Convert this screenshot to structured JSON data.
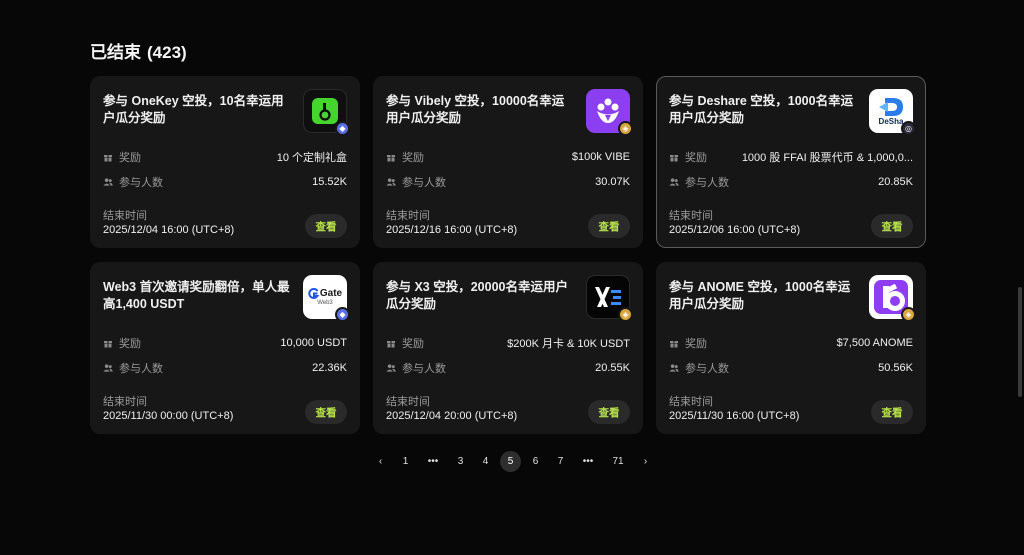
{
  "header": {
    "title": "已结束",
    "count": "(423)"
  },
  "labels": {
    "reward": "奖励",
    "participants": "参与人数",
    "end_time": "结束时间",
    "view": "查看"
  },
  "cards": [
    {
      "title": "参与 OneKey 空投，10名幸运用户瓜分奖励",
      "logo": "onekey-logo",
      "chain": "eth",
      "reward": "10 个定制礼盒",
      "participants": "15.52K",
      "end_time": "2025/12/04 16:00 (UTC+8)"
    },
    {
      "title": "参与 Vibely 空投，10000名幸运用户瓜分奖励",
      "logo": "vibely-logo",
      "chain": "bnb",
      "reward": "$100k VIBE",
      "participants": "30.07K",
      "end_time": "2025/12/16 16:00 (UTC+8)"
    },
    {
      "title": "参与 Deshare 空投，1000名幸运用户瓜分奖励",
      "logo": "deshare-logo",
      "chain": "dark",
      "reward": "1000 股 FFAI 股票代币 & 1,000,0...",
      "participants": "20.85K",
      "end_time": "2025/12/06 16:00 (UTC+8)"
    },
    {
      "title": "Web3 首次邀请奖励翻倍，单人最高1,400 USDT",
      "logo": "gate-web3-logo",
      "logo_text": "Gate",
      "logo_subtext": "Web3",
      "chain": "eth",
      "reward": "10,000 USDT",
      "participants": "22.36K",
      "end_time": "2025/11/30 00:00 (UTC+8)"
    },
    {
      "title": "参与 X3 空投，20000名幸运用户瓜分奖励",
      "logo": "x3-logo",
      "chain": "bnb",
      "reward": "$200K 月卡 & 10K USDT",
      "participants": "20.55K",
      "end_time": "2025/12/04 20:00 (UTC+8)"
    },
    {
      "title": "参与 ANOME 空投，1000名幸运用户瓜分奖励",
      "logo": "anome-logo",
      "chain": "bnb",
      "reward": "$7,500 ANOME",
      "participants": "50.56K",
      "end_time": "2025/11/30 16:00 (UTC+8)"
    }
  ],
  "pagination": {
    "prev": "‹",
    "items": [
      "1",
      "•••",
      "3",
      "4",
      "5",
      "6",
      "7",
      "•••",
      "71"
    ],
    "current": "5",
    "next": "›"
  },
  "colors": {
    "background": "#070707",
    "card": "#171717",
    "accent": "#b8e34a"
  }
}
